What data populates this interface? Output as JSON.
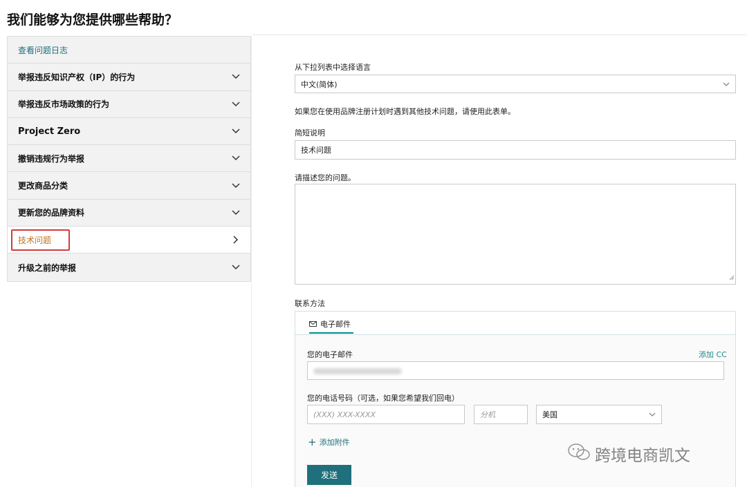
{
  "page": {
    "title": "我们能够为您提供哪些帮助？"
  },
  "sidebar": {
    "items": [
      {
        "label": "查看问题日志"
      },
      {
        "label": "举报违反知识产权（IP）的行为"
      },
      {
        "label": "举报违反市场政策的行为"
      },
      {
        "label": "Project Zero"
      },
      {
        "label": "撤销违规行为举报"
      },
      {
        "label": "更改商品分类"
      },
      {
        "label": "更新您的品牌资料"
      },
      {
        "label": "技术问题"
      },
      {
        "label": "升级之前的举报"
      }
    ]
  },
  "form": {
    "language_label": "从下拉列表中选择语言",
    "language_value": "中文(简体)",
    "notice": "如果您在使用品牌注册计划时遇到其他技术问题，请使用此表单。",
    "summary_label": "简短说明",
    "summary_value": "技术问题",
    "describe_label": "请描述您的问题。",
    "contact_label": "联系方法",
    "email_tab": "电子邮件",
    "your_email_label": "您的电子邮件",
    "add_cc": "添加 CC",
    "phone_label": "您的电话号码（可选，如果您希望我们回电）",
    "phone_placeholder": "(XXX) XXX-XXXX",
    "ext_placeholder": "分机",
    "country_value": "美国",
    "add_attachment": "添加附件",
    "send": "发送"
  },
  "watermark": {
    "text": "跨境电商凯文"
  },
  "colors": {
    "teal": "#1f6f7c",
    "accent_orange": "#c0741b",
    "highlight_red": "#d13b3b"
  }
}
